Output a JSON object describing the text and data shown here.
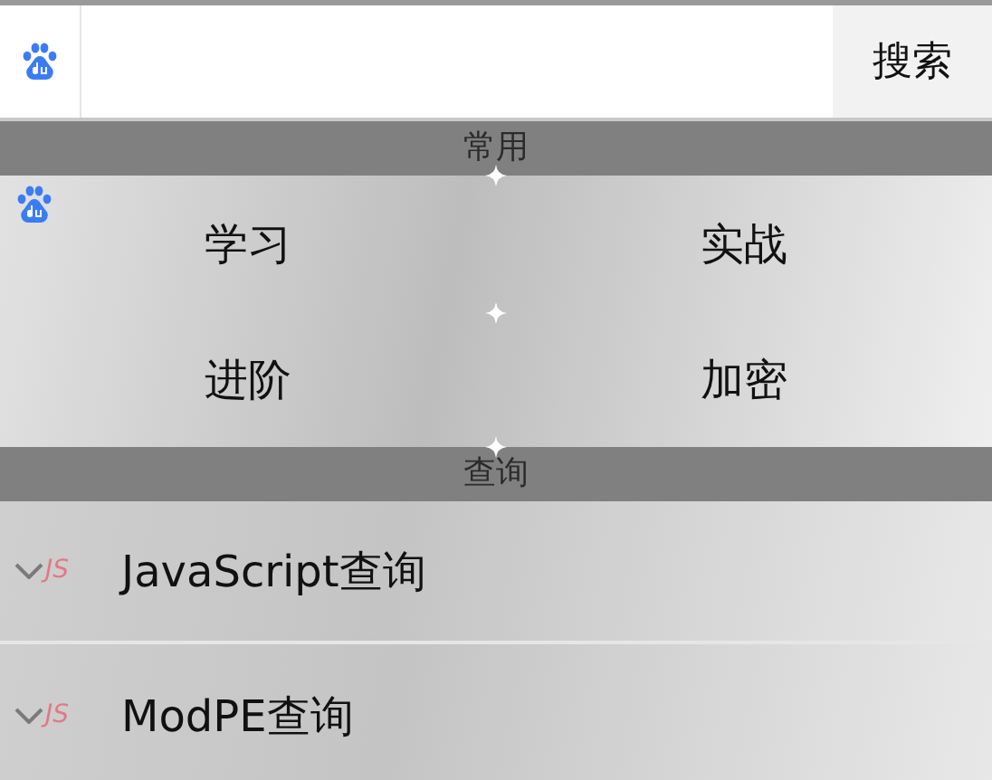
{
  "search": {
    "button": "搜索"
  },
  "sections": [
    {
      "title": "常用",
      "kind": "grid",
      "items": [
        {
          "label": "学习"
        },
        {
          "label": "实战"
        },
        {
          "label": "进阶"
        },
        {
          "label": "加密"
        }
      ]
    },
    {
      "title": "查询",
      "kind": "list",
      "items": [
        {
          "tag": "JS",
          "label": "JavaScript查询"
        },
        {
          "tag": "JS",
          "label": "ModPE查询"
        }
      ]
    }
  ]
}
